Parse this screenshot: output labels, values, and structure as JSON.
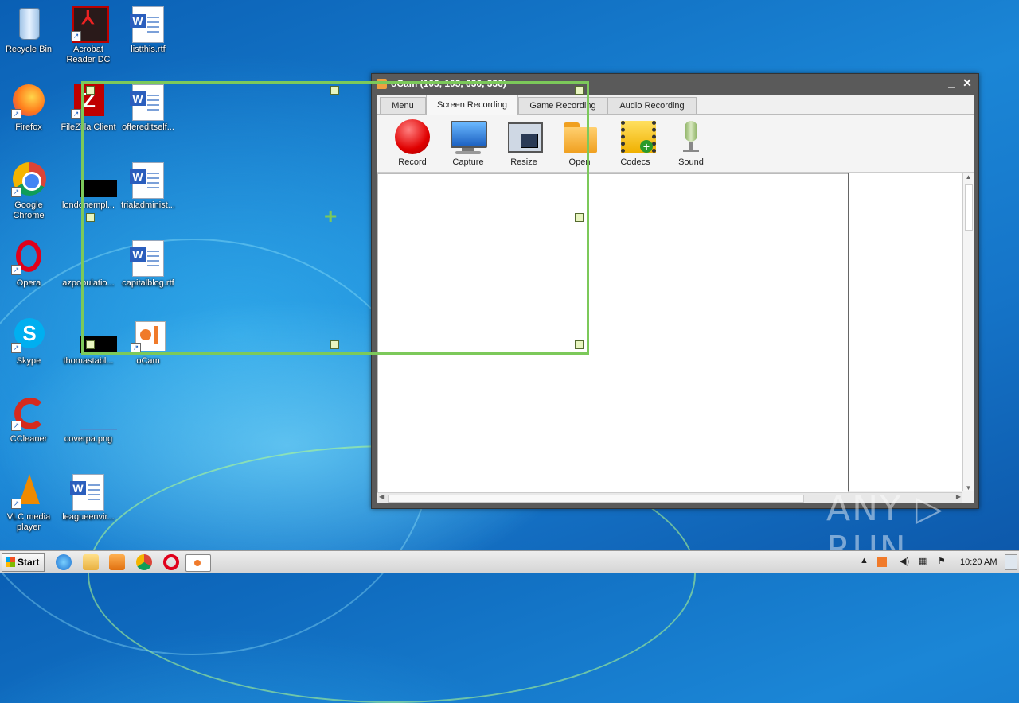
{
  "desktop": {
    "icons": [
      {
        "label": "Recycle Bin"
      },
      {
        "label": "Acrobat Reader DC"
      },
      {
        "label": "listthis.rtf"
      },
      {
        "label": "Firefox"
      },
      {
        "label": "FileZilla Client"
      },
      {
        "label": "offereditself..."
      },
      {
        "label": "Google Chrome"
      },
      {
        "label": "londonempl..."
      },
      {
        "label": "trialadminist..."
      },
      {
        "label": "Opera"
      },
      {
        "label": "azpopulatio..."
      },
      {
        "label": "capitalblog.rtf"
      },
      {
        "label": "Skype"
      },
      {
        "label": "thomastabl..."
      },
      {
        "label": "oCam"
      },
      {
        "label": "CCleaner"
      },
      {
        "label": "coverpa.png"
      },
      {
        "label": "VLC media player"
      },
      {
        "label": "leagueenvir..."
      }
    ]
  },
  "window": {
    "title": "oCam (103, 103, 636, 336)",
    "minimize": "_",
    "close": "✕",
    "tabs": [
      {
        "label": "Menu"
      },
      {
        "label": "Screen Recording",
        "active": true
      },
      {
        "label": "Game Recording"
      },
      {
        "label": "Audio Recording"
      }
    ],
    "tools": [
      {
        "label": "Record",
        "icon": "record-icon"
      },
      {
        "label": "Capture",
        "icon": "monitor-icon"
      },
      {
        "label": "Resize",
        "icon": "resize-icon"
      },
      {
        "label": "Open",
        "icon": "folder-icon"
      },
      {
        "label": "Codecs",
        "icon": "film-plus-icon"
      },
      {
        "label": "Sound",
        "icon": "microphone-icon"
      }
    ]
  },
  "taskbar": {
    "start_label": "Start",
    "clock": "10:20 AM"
  },
  "watermark": "ANY ▷ RUN",
  "colors": {
    "selection": "#7cc95a",
    "desktop": "#1b86d6"
  }
}
